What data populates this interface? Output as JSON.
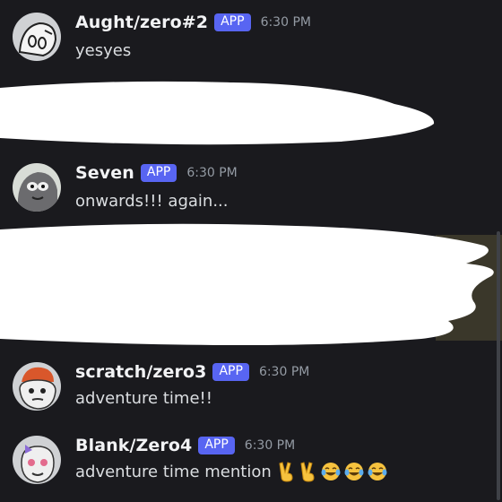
{
  "messages": [
    {
      "username": "Aught/zero#2",
      "badge": "APP",
      "time": "6:30 PM",
      "text": "yesyes",
      "avatar_icon": "ghost-face-avatar"
    },
    {
      "username": "Seven",
      "badge": "APP",
      "time": "6:30 PM",
      "text": "onwards!!! again...",
      "avatar_icon": "grey-creature-avatar"
    },
    {
      "username": "scratch/zero3",
      "badge": "APP",
      "time": "6:30 PM",
      "text": "adventure time!!",
      "avatar_icon": "capped-face-avatar"
    },
    {
      "username": "Blank/Zero4",
      "badge": "APP",
      "time": "6:30 PM",
      "text": "adventure time mention",
      "emojis": [
        "victory-hand",
        "victory-hand",
        "tears-of-joy",
        "tears-of-joy",
        "tears-of-joy"
      ],
      "avatar_icon": "bow-face-avatar"
    }
  ],
  "colors": {
    "background": "#1a1a1e",
    "badge": "#5865f2",
    "username": "#f2f3f5",
    "message_text": "#dbdee1",
    "timestamp": "#949ba4",
    "redaction": "#ffffff"
  }
}
